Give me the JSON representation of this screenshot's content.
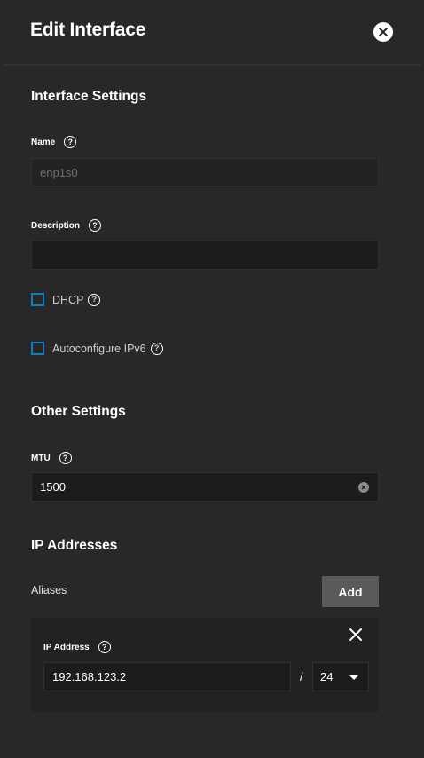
{
  "header": {
    "title": "Edit Interface"
  },
  "interface_settings": {
    "title": "Interface Settings",
    "name": {
      "label": "Name",
      "value": "enp1s0"
    },
    "description": {
      "label": "Description",
      "value": ""
    },
    "dhcp": {
      "label": "DHCP",
      "checked": false
    },
    "autoconfigure_ipv6": {
      "label": "Autoconfigure IPv6",
      "checked": false
    }
  },
  "other_settings": {
    "title": "Other Settings",
    "mtu": {
      "label": "MTU",
      "value": "1500"
    }
  },
  "ip_addresses": {
    "title": "IP Addresses",
    "aliases_label": "Aliases",
    "add_label": "Add",
    "aliases": [
      {
        "label": "IP Address",
        "ip": "192.168.123.2",
        "separator": "/",
        "netmask": "24"
      }
    ]
  },
  "help_glyph": "?",
  "colors": {
    "background": "#282828",
    "input_bg": "#1c1c1c",
    "checkbox_border": "#0d7fc1",
    "button_bg": "#5a5a5a"
  }
}
